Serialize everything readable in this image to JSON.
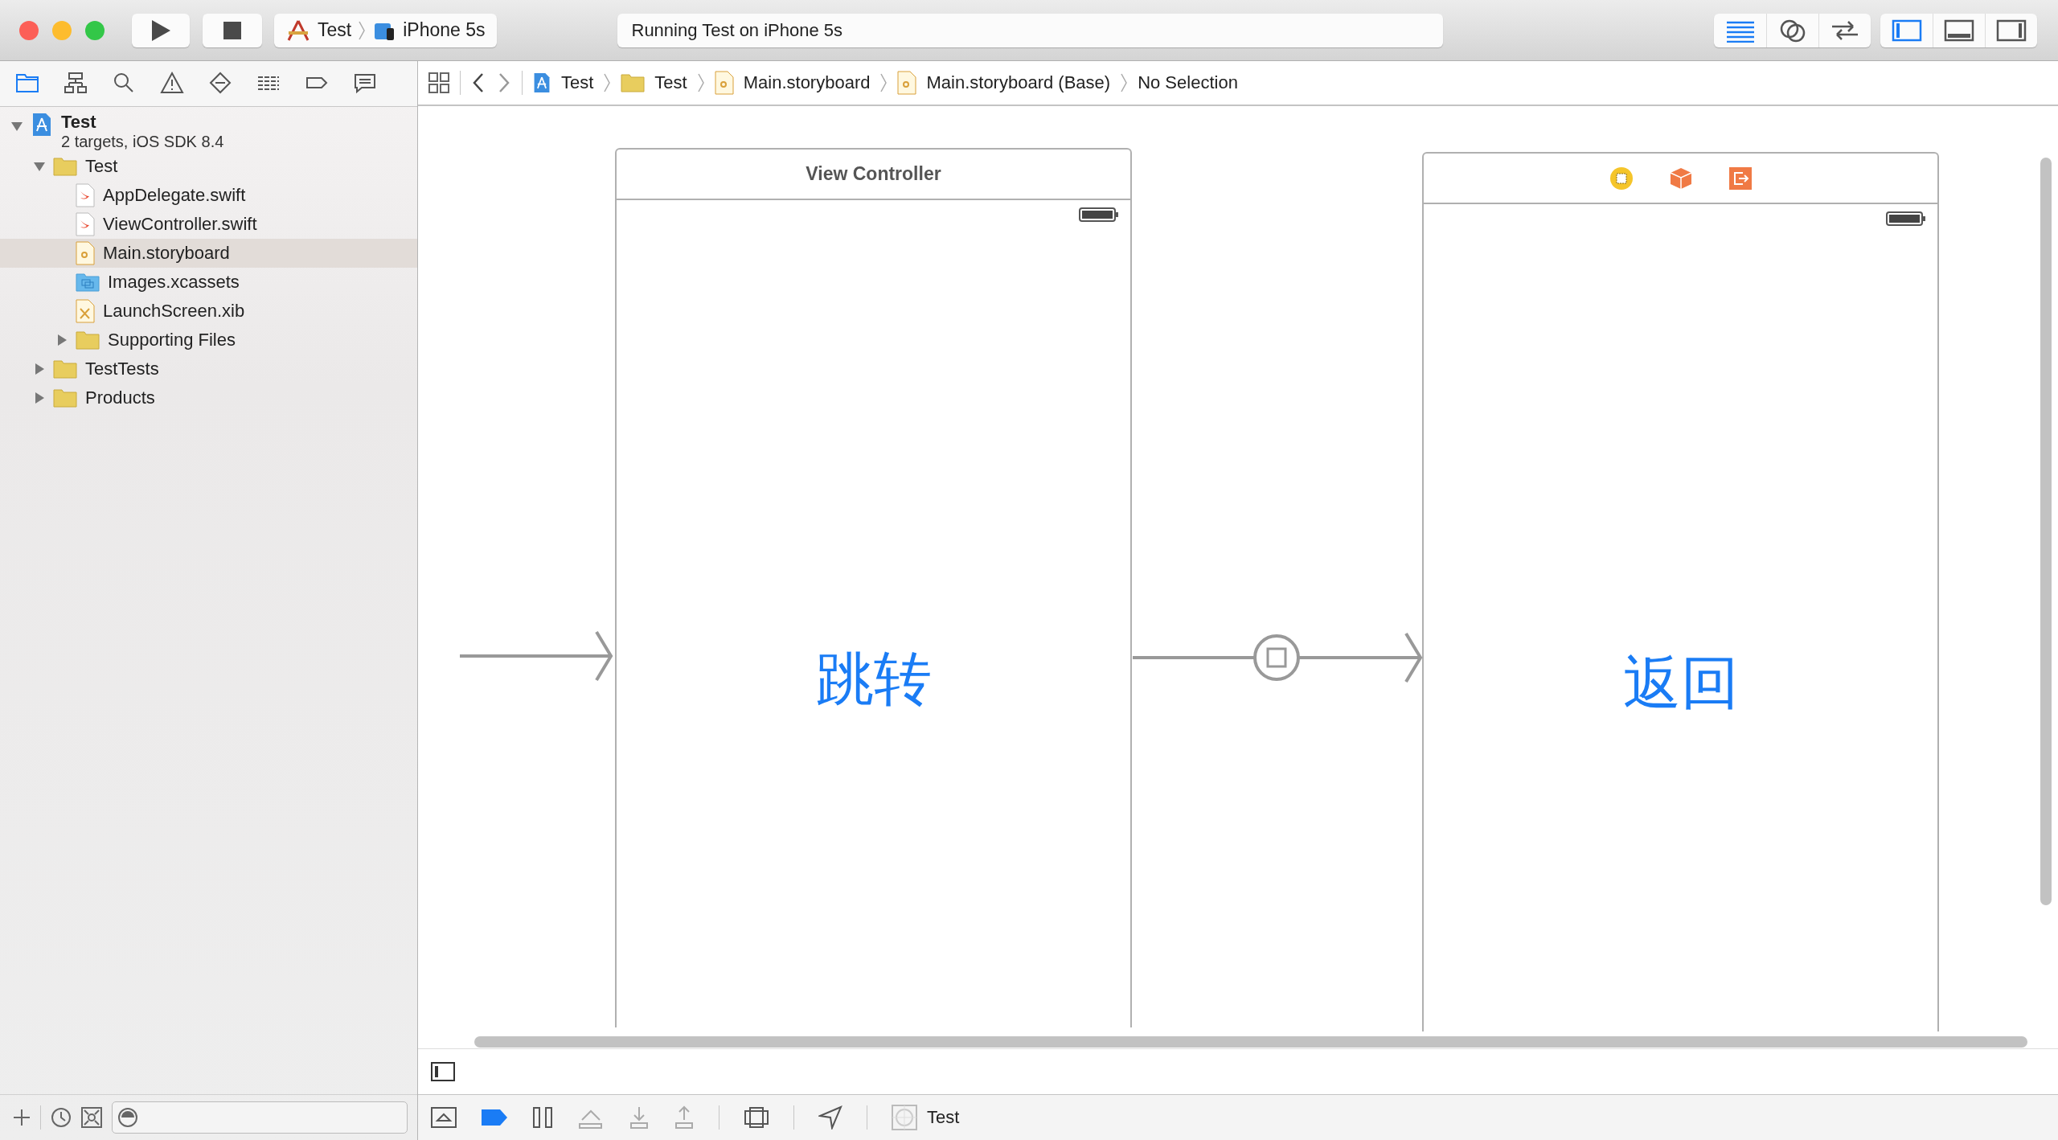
{
  "toolbar": {
    "scheme": {
      "target": "Test",
      "device": "iPhone 5s"
    },
    "activity": "Running Test on iPhone 5s",
    "editor_modes": [
      {
        "kind": "standard",
        "selected": true
      },
      {
        "kind": "assistant",
        "selected": false
      },
      {
        "kind": "version",
        "selected": false
      }
    ],
    "panels": [
      {
        "kind": "navigator",
        "on": true
      },
      {
        "kind": "debug",
        "on": false
      },
      {
        "kind": "utilities",
        "on": false
      }
    ]
  },
  "navigator_tabs": [
    {
      "kind": "project",
      "selected": true
    },
    {
      "kind": "symbol",
      "selected": false
    },
    {
      "kind": "find",
      "selected": false
    },
    {
      "kind": "issue",
      "selected": false
    },
    {
      "kind": "test",
      "selected": false
    },
    {
      "kind": "debug",
      "selected": false
    },
    {
      "kind": "breakpoint",
      "selected": false
    },
    {
      "kind": "report",
      "selected": false
    }
  ],
  "project_tree": [
    {
      "name": "Test",
      "subtitle": "2 targets, iOS SDK 8.4",
      "kind": "project",
      "expanded": true,
      "selected": false,
      "children": [
        {
          "name": "Test",
          "kind": "folder",
          "expanded": true,
          "selected": false,
          "children": [
            {
              "name": "AppDelegate.swift",
              "kind": "swift",
              "selected": false
            },
            {
              "name": "ViewController.swift",
              "kind": "swift",
              "selected": false
            },
            {
              "name": "Main.storyboard",
              "kind": "storyboard",
              "selected": true
            },
            {
              "name": "Images.xcassets",
              "kind": "xcassets",
              "selected": false
            },
            {
              "name": "LaunchScreen.xib",
              "kind": "xib",
              "selected": false
            },
            {
              "name": "Supporting Files",
              "kind": "folder",
              "expanded": false,
              "selected": false
            }
          ]
        },
        {
          "name": "TestTests",
          "kind": "folder",
          "expanded": false,
          "selected": false
        },
        {
          "name": "Products",
          "kind": "folder",
          "expanded": false,
          "selected": false
        }
      ]
    }
  ],
  "jump_bar": [
    {
      "label": "Test",
      "kind": "project"
    },
    {
      "label": "Test",
      "kind": "folder"
    },
    {
      "label": "Main.storyboard",
      "kind": "storyboard"
    },
    {
      "label": "Main.storyboard (Base)",
      "kind": "storyboard"
    },
    {
      "label": "No Selection",
      "kind": "none"
    }
  ],
  "scenes": [
    {
      "title": "View Controller",
      "button": "跳转"
    },
    {
      "dock_icons": [
        {
          "kind": "view_controller"
        },
        {
          "kind": "first_responder"
        },
        {
          "kind": "exit"
        }
      ],
      "button": "返回"
    }
  ],
  "bottom_bar": {
    "scheme": "Test"
  }
}
